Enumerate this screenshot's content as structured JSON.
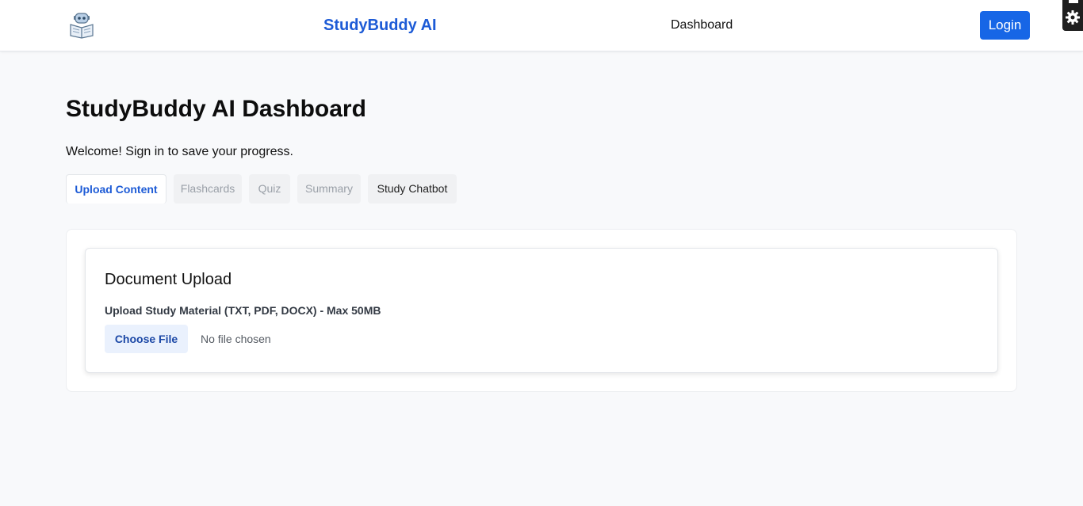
{
  "navbar": {
    "brand": "StudyBuddy AI",
    "nav_link": "Dashboard",
    "login_label": "Login",
    "logo_icon": "robot-reading-book-icon"
  },
  "settings_widget": {
    "icon": "gear-icon"
  },
  "page": {
    "title": "StudyBuddy AI Dashboard",
    "welcome": "Welcome! Sign in to save your progress."
  },
  "tabs": [
    {
      "label": "Upload Content",
      "state": "active"
    },
    {
      "label": "Flashcards",
      "state": "disabled"
    },
    {
      "label": "Quiz",
      "state": "disabled"
    },
    {
      "label": "Summary",
      "state": "disabled"
    },
    {
      "label": "Study Chatbot",
      "state": "enabled"
    }
  ],
  "upload_card": {
    "title": "Document Upload",
    "label": "Upload Study Material (TXT, PDF, DOCX) - Max 50MB",
    "choose_file_label": "Choose File",
    "file_status": "No file chosen"
  },
  "colors": {
    "accent": "#1d5bd6",
    "login_button": "#1766e6",
    "background": "#f8f9fb"
  }
}
